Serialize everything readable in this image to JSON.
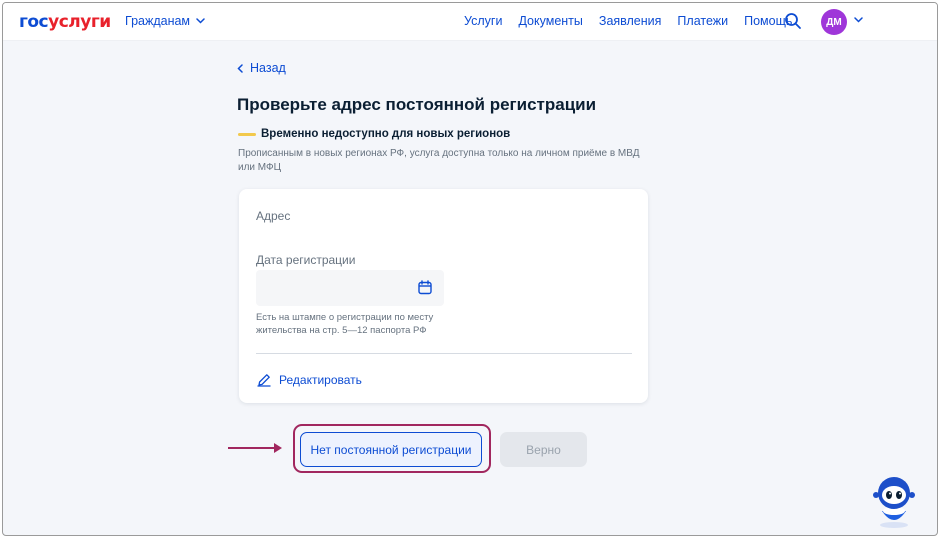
{
  "header": {
    "logo_part1": "гос",
    "logo_part2": "услуги",
    "audience_menu": "Гражданам",
    "nav": [
      "Услуги",
      "Документы",
      "Заявления",
      "Платежи",
      "Помощь"
    ],
    "avatar_initials": "ДМ"
  },
  "page": {
    "back_label": "Назад",
    "title": "Проверьте адрес постоянной регистрации",
    "notice_title": "Временно недоступно для новых регионов",
    "notice_text": "Прописанным в новых регионах РФ, услуга доступна только на личном приёме в МВД или МФЦ"
  },
  "card": {
    "address_label": "Адрес",
    "date_label": "Дата регистрации",
    "date_value": "",
    "hint": "Есть на штампе о регистрации по месту жительства на стр. 5—12 паспорта РФ",
    "edit_label": "Редактировать"
  },
  "actions": {
    "no_registration_label": "Нет постоянной регистрации",
    "confirm_label": "Верно"
  },
  "colors": {
    "accent": "#0d4cd3",
    "brand_red": "#e8212b",
    "annotation": "#a1275e",
    "notice_marker": "#f2c94c",
    "avatar_bg": "#9f36d9"
  }
}
